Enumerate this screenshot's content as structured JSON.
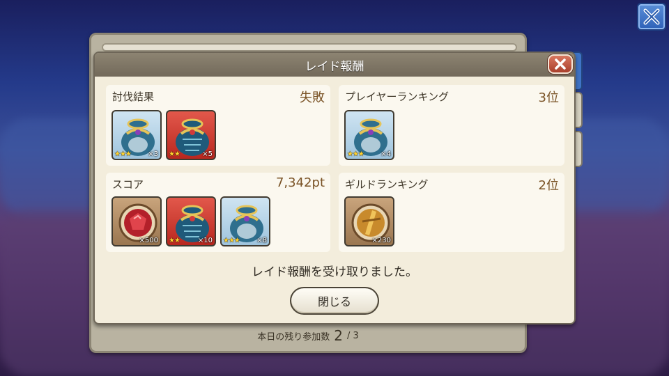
{
  "dialog": {
    "title": "レイド報酬",
    "message": "レイド報酬を受け取りました。",
    "close_button_label": "閉じる"
  },
  "cards": {
    "result": {
      "title": "討伐結果",
      "value": "失敗",
      "items": [
        {
          "icon": "blue-treasure-bag-icon",
          "stars": "★★★",
          "qty": "×3"
        },
        {
          "icon": "red-treasure-bag-icon",
          "stars": "★★",
          "qty": "×5"
        }
      ]
    },
    "player_ranking": {
      "title": "プレイヤーランキング",
      "value": "3位",
      "items": [
        {
          "icon": "blue-treasure-bag-icon",
          "stars": "★★★",
          "qty": "×4"
        }
      ]
    },
    "score": {
      "title": "スコア",
      "value": "7,342pt",
      "items": [
        {
          "icon": "red-gem-icon",
          "stars": "",
          "qty": "×500"
        },
        {
          "icon": "red-treasure-bag-icon",
          "stars": "★★",
          "qty": "×10"
        },
        {
          "icon": "blue-treasure-bag-icon",
          "stars": "★★★",
          "qty": "×8"
        }
      ]
    },
    "guild_ranking": {
      "title": "ギルドランキング",
      "value": "2位",
      "items": [
        {
          "icon": "golden-medal-icon",
          "stars": "",
          "qty": "×230"
        }
      ]
    }
  },
  "footer": {
    "remaining_label": "本日の残り参加数",
    "remaining_count": "2",
    "remaining_total": "/ 3"
  },
  "colors": {
    "header": "#7d7463",
    "panel": "#f3eddc",
    "value_text": "#7a5326",
    "close_red": "#c45a44",
    "top_close_blue": "#3f74c6"
  }
}
